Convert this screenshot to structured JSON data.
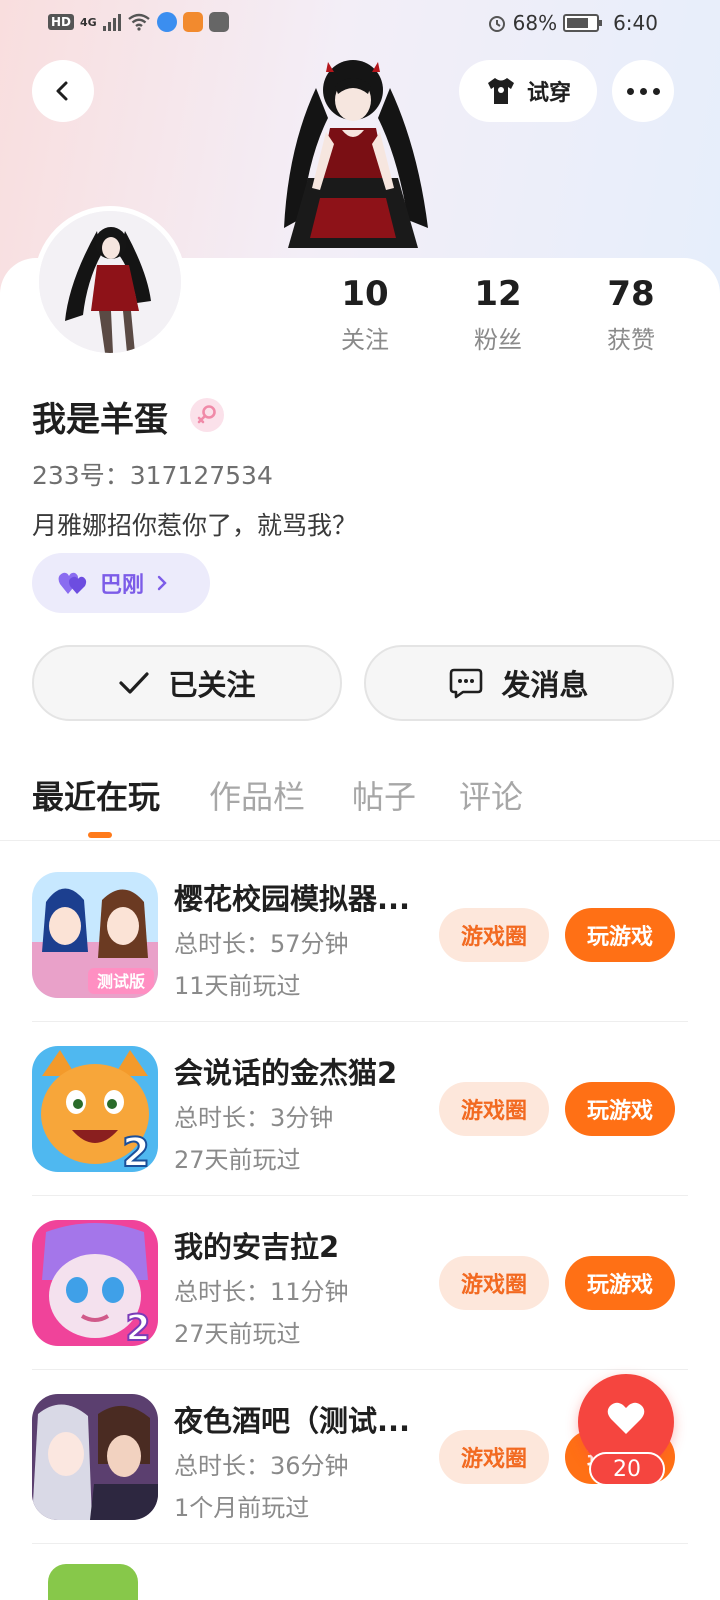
{
  "status_bar": {
    "network_badge": "HD",
    "network_type": "4G",
    "battery_percent": "68%",
    "battery_level": 0.68,
    "time": "6:40"
  },
  "header": {
    "tryon_label": "试穿"
  },
  "profile": {
    "stats": [
      {
        "value": "10",
        "label": "关注"
      },
      {
        "value": "12",
        "label": "粉丝"
      },
      {
        "value": "78",
        "label": "获赞"
      }
    ],
    "username": "我是羊蛋",
    "gender": "female",
    "user_id": "233号：317127534",
    "bio": "月雅娜招你惹你了，就骂我？",
    "tag_label": "巴刚"
  },
  "actions": {
    "follow_label": "已关注",
    "message_label": "发消息"
  },
  "tabs": [
    {
      "label": "最近在玩",
      "active": true
    },
    {
      "label": "作品栏",
      "active": false
    },
    {
      "label": "帖子",
      "active": false
    },
    {
      "label": "评论",
      "active": false
    }
  ],
  "games": [
    {
      "title": "樱花校园模拟器...",
      "duration": "总时长：57分钟",
      "last_played": "11天前玩过",
      "circle_label": "游戏圈",
      "play_label": "玩游戏",
      "icon": "sakura-school-icon",
      "icon_badge": "测试版"
    },
    {
      "title": "会说话的金杰猫2",
      "duration": "总时长：3分钟",
      "last_played": "27天前玩过",
      "circle_label": "游戏圈",
      "play_label": "玩游戏",
      "icon": "talking-ginger-icon",
      "icon_badge": "2"
    },
    {
      "title": "我的安吉拉2",
      "duration": "总时长：11分钟",
      "last_played": "27天前玩过",
      "circle_label": "游戏圈",
      "play_label": "玩游戏",
      "icon": "my-angela-icon",
      "icon_badge": "2"
    },
    {
      "title": "夜色酒吧（测试...",
      "duration": "总时长：36分钟",
      "last_played": "1个月前玩过",
      "circle_label": "游戏圈",
      "play_label": "玩游戏",
      "icon": "night-bar-icon",
      "icon_badge": ""
    }
  ],
  "like_fab": {
    "count": "20"
  },
  "colors": {
    "accent": "#ff7015",
    "accent_light": "#fde7db",
    "like_red": "#f5453f",
    "tag_purple": "#7c5ce8"
  }
}
